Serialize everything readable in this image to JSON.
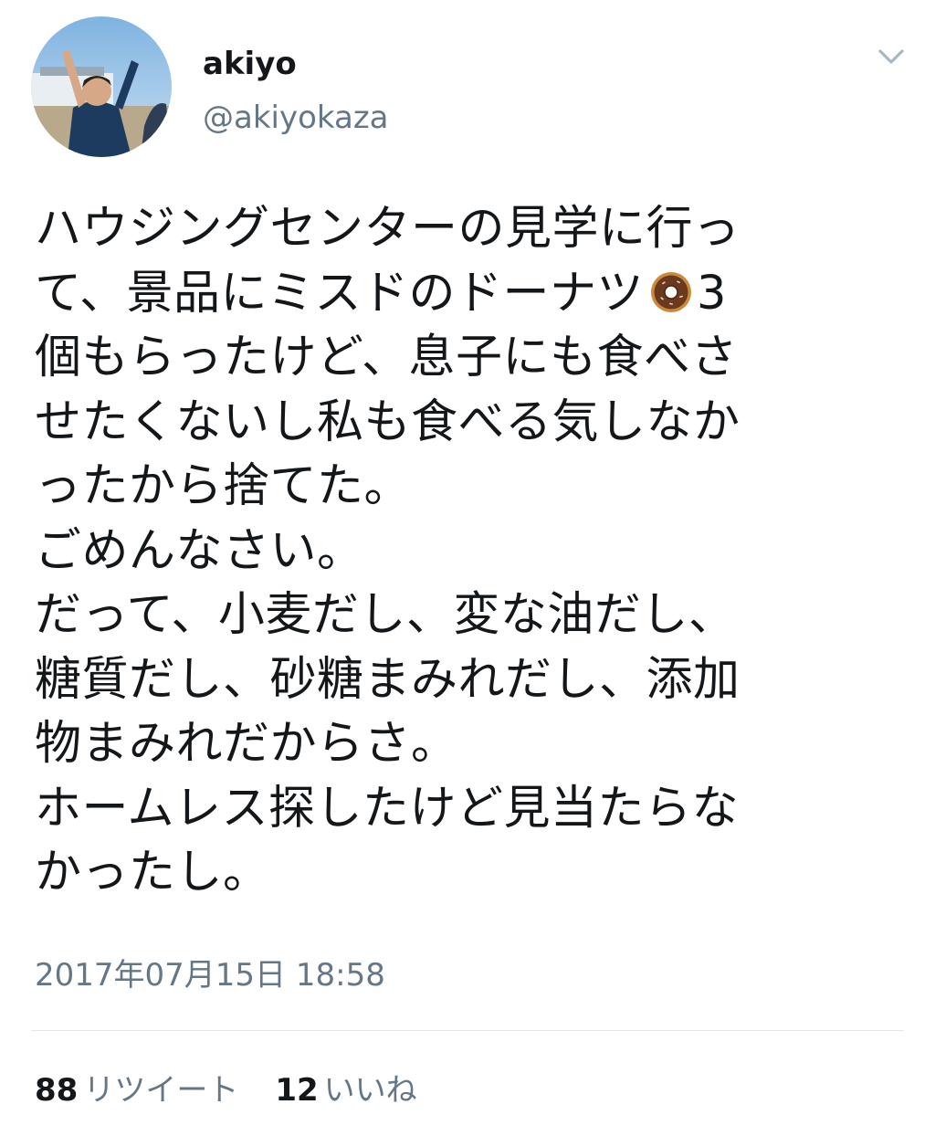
{
  "user": {
    "display_name": "akiyo",
    "handle": "@akiyokaza"
  },
  "icons": {
    "caret": "chevron-down-icon",
    "emoji": "donut-emoji-icon"
  },
  "tweet": {
    "lines": [
      "ハウジングセンターの見学に行っ",
      "て、景品にミスドのドーナツ",
      "3",
      "個もらったけど、息子にも食べさ",
      "せたくないし私も食べる気しなか",
      "ったから捨てた。",
      "ごめんなさい。",
      "だって、小麦だし、変な油だし、",
      "糖質だし、砂糖まみれだし、添加",
      "物まみれだからさ。",
      "ホームレス探したけど見当たらな",
      "かったし。"
    ]
  },
  "timestamp": "2017年07月15日 18:58",
  "stats": {
    "retweets_count": "88",
    "retweets_label": "リツイート",
    "likes_count": "12",
    "likes_label": "いいね"
  },
  "colors": {
    "text": "#14171a",
    "secondary": "#657786",
    "divider": "#e1e8ed"
  }
}
